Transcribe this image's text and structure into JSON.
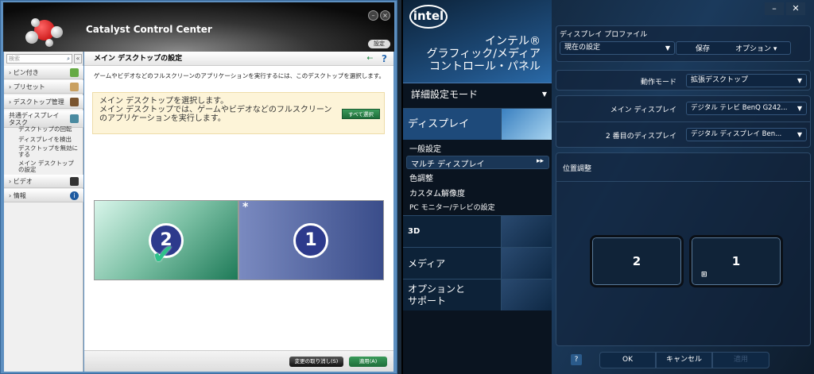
{
  "ccc": {
    "title": "Catalyst Control Center",
    "settings_label": "設定",
    "search_placeholder": "検索",
    "sidebar": [
      {
        "label": "ピン付き"
      },
      {
        "label": "プリセット"
      },
      {
        "label": "デスクトップ管理"
      },
      {
        "label": "共通ディスプレイ\nタスク",
        "sub": [
          "デスクトップの回転",
          "ディスプレイを検出",
          "デスクトップを無効にする",
          "メイン デスクトップの設定"
        ]
      },
      {
        "label": "ビデオ"
      },
      {
        "label": "情報"
      }
    ],
    "page_title": "メイン デスクトップの設定",
    "description": "ゲームやビデオなどのフルスクリーンのアプリケーションを実行するには、このデスクトップを選択します。",
    "info_line1": "メイン デスクトップを選択します。",
    "info_line2": "メイン デスクトップでは、ゲームやビデオなどのフルスクリーン",
    "info_line3": "のアプリケーションを実行します。",
    "select_all": "すべて選択",
    "monitors": [
      {
        "num": "2",
        "selected": true
      },
      {
        "num": "1",
        "mark": "*"
      }
    ],
    "discard": "変更の取り消し(S)",
    "apply": "適用(A)"
  },
  "intel": {
    "brand": "intel",
    "title1": "インテル®",
    "title2": "グラフィック/メディア",
    "title3": "コントロール・パネル",
    "mode": "詳細設定モード",
    "display": "ディスプレイ",
    "sub": [
      "一般設定",
      "マルチ ディスプレイ",
      "色調整",
      "カスタム解像度",
      "PC モニター/テレビの設定"
    ],
    "nav3d": "3D",
    "media": "メディア",
    "options1": "オプションと",
    "options2": "サポート",
    "profile_label": "ディスプレイ プロファイル",
    "profile_value": "現在の設定",
    "save": "保存",
    "options_btn": "オプション ▾",
    "op_mode_label": "動作モード",
    "op_mode_value": "拡張デスクトップ",
    "main_label": "メイン ディスプレイ",
    "main_value": "デジタル テレビ BenQ G242...",
    "second_label": "2 番目のディスプレイ",
    "second_value": "デジタル ディスプレイ Ben...",
    "position_label": "位置調整",
    "mon_a": "2",
    "mon_b": "1",
    "help": "?",
    "ok": "OK",
    "cancel": "キャンセル",
    "apply": "適用"
  }
}
